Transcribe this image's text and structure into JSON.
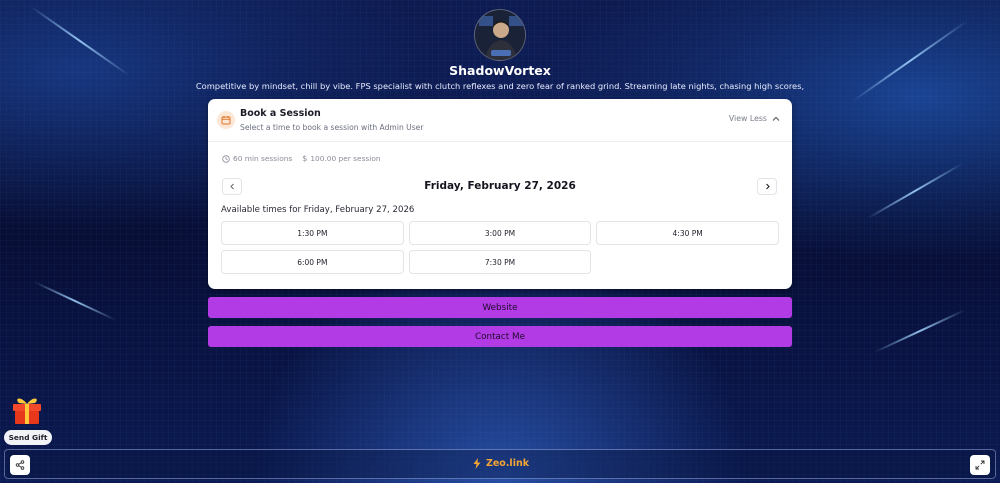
{
  "profile": {
    "username": "ShadowVortex",
    "bio": "Competitive by mindset, chill by vibe. FPS specialist with clutch reflexes and zero fear of ranked grind. Streaming late nights, chasing high scores,"
  },
  "booking": {
    "title": "Book a Session",
    "subtitle": "Select a time to book a session with Admin User",
    "toggle_label": "View Less",
    "duration": "60 min sessions",
    "price": "100.00 per session",
    "date_title": "Friday, February 27, 2026",
    "available_label": "Available times for Friday, February 27, 2026",
    "slots": [
      "1:30 PM",
      "3:00 PM",
      "4:30 PM",
      "6:00 PM",
      "7:30 PM"
    ]
  },
  "links": {
    "website": "Website",
    "contact": "Contact Me"
  },
  "gift": {
    "label": "Send Gift"
  },
  "footer": {
    "brand": "Zeo.link"
  },
  "colors": {
    "link_button": "#b33be6",
    "brand": "#f3a534",
    "calendar_badge": "#fde7d6"
  }
}
